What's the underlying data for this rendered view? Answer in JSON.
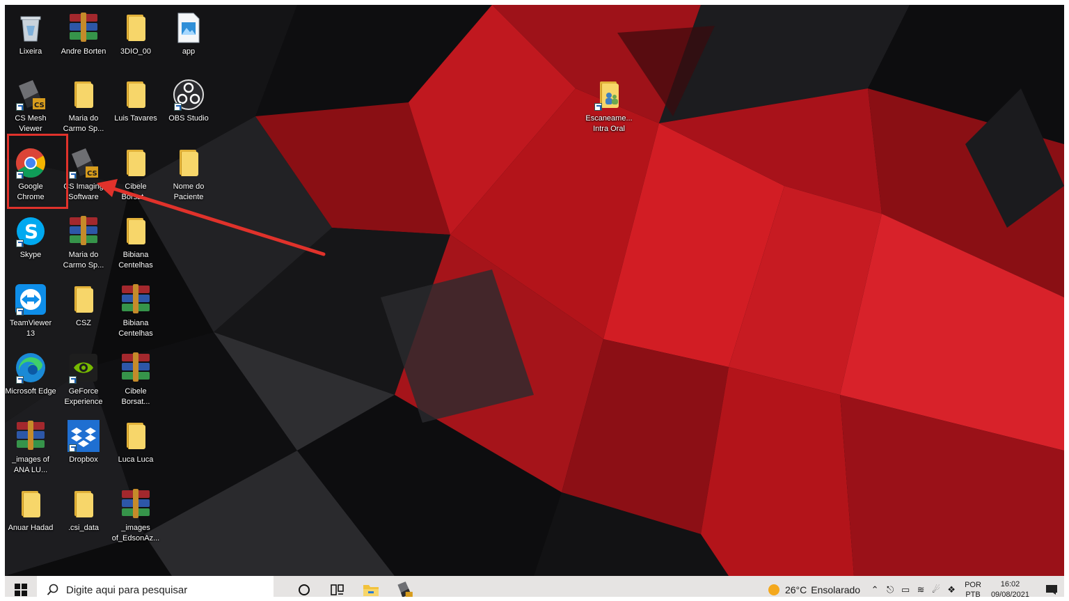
{
  "desktop": {
    "icons": [
      {
        "label": "Lixeira",
        "icon": "recycle-bin-icon"
      },
      {
        "label": "Andre Borten",
        "icon": "winrar-archive-icon"
      },
      {
        "label": "3DIO_00",
        "icon": "folder-icon"
      },
      {
        "label": "app",
        "icon": "image-file-icon"
      },
      {
        "label": "CS Mesh Viewer",
        "icon": "cs-app-icon"
      },
      {
        "label": "Maria do Carmo Sp...",
        "icon": "folder-icon"
      },
      {
        "label": "Luis Tavares",
        "icon": "folder-icon"
      },
      {
        "label": "OBS Studio",
        "icon": "obs-studio-icon"
      },
      {
        "label": "Google Chrome",
        "icon": "chrome-icon"
      },
      {
        "label": "CS Imaging Software",
        "icon": "cs-app-icon"
      },
      {
        "label": "Cibele Borsat...",
        "icon": "folder-icon"
      },
      {
        "label": "Nome do Paciente",
        "icon": "folder-icon"
      },
      {
        "label": "Skype",
        "icon": "skype-icon"
      },
      {
        "label": "Maria do Carmo Sp...",
        "icon": "winrar-archive-icon"
      },
      {
        "label": "Bibiana Centelhas",
        "icon": "folder-icon"
      },
      {
        "label": "TeamViewer 13",
        "icon": "teamviewer-icon"
      },
      {
        "label": "CSZ",
        "icon": "folder-icon"
      },
      {
        "label": "Bibiana Centelhas",
        "icon": "winrar-archive-icon"
      },
      {
        "label": "Microsoft Edge",
        "icon": "edge-icon"
      },
      {
        "label": "GeForce Experience",
        "icon": "geforce-icon"
      },
      {
        "label": "Cibele Borsat...",
        "icon": "winrar-archive-icon"
      },
      {
        "label": "_images of ANA LU...",
        "icon": "winrar-archive-icon"
      },
      {
        "label": "Dropbox",
        "icon": "dropbox-icon"
      },
      {
        "label": "Luca Luca",
        "icon": "folder-icon"
      },
      {
        "label": "Anuar Hadad",
        "icon": "folder-icon"
      },
      {
        "label": ".csi_data",
        "icon": "folder-icon"
      },
      {
        "label": "_images of_EdsonAz...",
        "icon": "winrar-archive-icon"
      },
      {
        "label": "Escaneame... Intra Oral",
        "icon": "scan-folder-icon"
      }
    ]
  },
  "annotation": {
    "color": "#e0322b",
    "target": "Google Chrome"
  },
  "taskbar": {
    "search_placeholder": "Digite aqui para pesquisar",
    "pinned": [
      "cortana-icon",
      "task-view-icon",
      "file-explorer-icon",
      "cs-app-icon"
    ],
    "weather": {
      "temp": "26°C",
      "condition": "Ensolarado"
    },
    "language": {
      "line1": "POR",
      "line2": "PTB"
    },
    "clock": {
      "time": "16:02",
      "date": "09/08/2021"
    }
  },
  "colors": {
    "wallpaper_red": "#b3141a",
    "wallpaper_dark": "#0b0b0c",
    "taskbar_bg": "#e6e4e3"
  }
}
